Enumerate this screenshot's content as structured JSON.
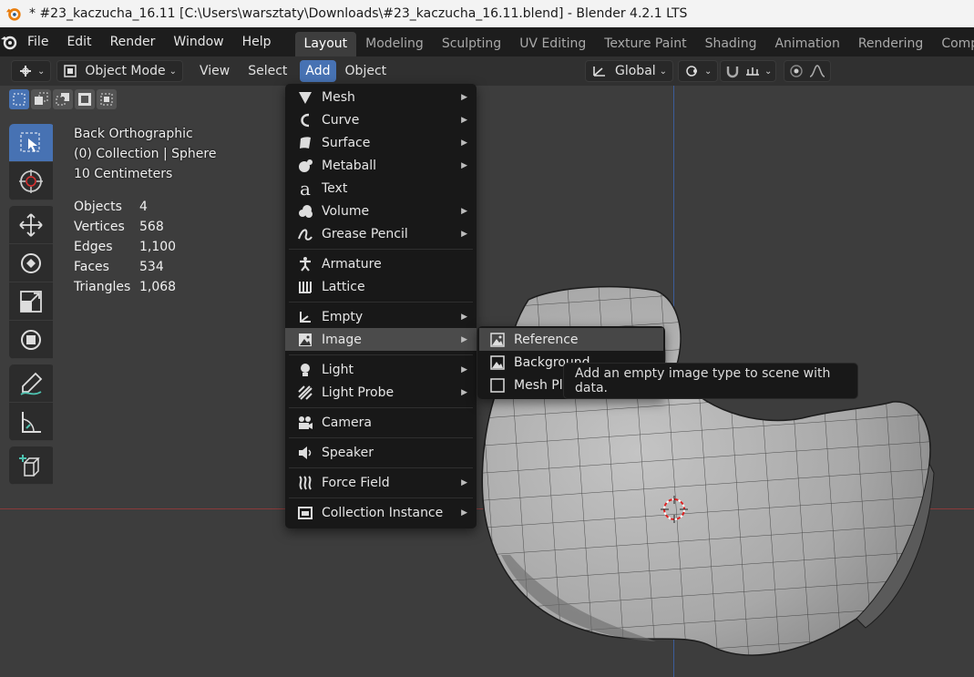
{
  "window_title": "* #23_kaczucha_16.11 [C:\\Users\\warsztaty\\Downloads\\#23_kaczucha_16.11.blend] - Blender 4.2.1 LTS",
  "top_menu": [
    "File",
    "Edit",
    "Render",
    "Window",
    "Help"
  ],
  "workspace_tabs": [
    "Layout",
    "Modeling",
    "Sculpting",
    "UV Editing",
    "Texture Paint",
    "Shading",
    "Animation",
    "Rendering",
    "Comp"
  ],
  "header": {
    "mode": "Object Mode",
    "menus": [
      "View",
      "Select",
      "Add",
      "Object"
    ],
    "transform_orientation": "Global"
  },
  "viewport_info": {
    "view": "Back Orthographic",
    "collection": "(0) Collection | Sphere",
    "scale": "10 Centimeters"
  },
  "stats": [
    {
      "label": "Objects",
      "value": "4"
    },
    {
      "label": "Vertices",
      "value": "568"
    },
    {
      "label": "Edges",
      "value": "1,100"
    },
    {
      "label": "Faces",
      "value": "534"
    },
    {
      "label": "Triangles",
      "value": "1,068"
    }
  ],
  "add_menu": {
    "items": [
      {
        "label": "Mesh",
        "icon": "mesh-icon",
        "submenu": true
      },
      {
        "label": "Curve",
        "icon": "curve-icon",
        "submenu": true
      },
      {
        "label": "Surface",
        "icon": "surface-icon",
        "submenu": true
      },
      {
        "label": "Metaball",
        "icon": "metaball-icon",
        "submenu": true
      },
      {
        "label": "Text",
        "icon": "text-icon",
        "submenu": false
      },
      {
        "label": "Volume",
        "icon": "volume-icon",
        "submenu": true
      },
      {
        "label": "Grease Pencil",
        "icon": "grease-pencil-icon",
        "submenu": true
      },
      {
        "label": "Armature",
        "icon": "armature-icon",
        "submenu": false
      },
      {
        "label": "Lattice",
        "icon": "lattice-icon",
        "submenu": false
      },
      {
        "label": "Empty",
        "icon": "empty-icon",
        "submenu": true
      },
      {
        "label": "Image",
        "icon": "image-icon",
        "submenu": true
      },
      {
        "label": "Light",
        "icon": "light-icon",
        "submenu": true
      },
      {
        "label": "Light Probe",
        "icon": "light-probe-icon",
        "submenu": true
      },
      {
        "label": "Camera",
        "icon": "camera-icon",
        "submenu": false
      },
      {
        "label": "Speaker",
        "icon": "speaker-icon",
        "submenu": false
      },
      {
        "label": "Force Field",
        "icon": "force-field-icon",
        "submenu": true
      },
      {
        "label": "Collection Instance",
        "icon": "collection-instance-icon",
        "submenu": true
      }
    ]
  },
  "image_submenu": [
    "Reference",
    "Background",
    "Mesh Pl"
  ],
  "tooltip": "Add an empty image type to scene with data.",
  "colors": {
    "accent": "#4772b3",
    "menu_bg": "#181818",
    "viewport_bg": "#3d3d3d"
  }
}
